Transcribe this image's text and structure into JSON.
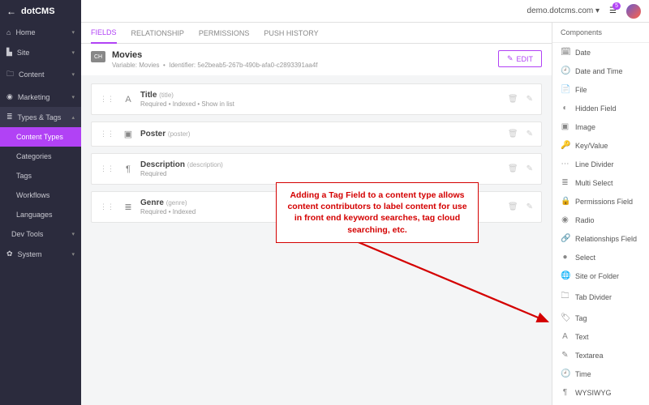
{
  "topbar": {
    "domain": "demo.dotcms.com",
    "notification_count": "5"
  },
  "sidebar": {
    "items": [
      {
        "label": "Home",
        "icon": "⌂"
      },
      {
        "label": "Site",
        "icon": "▙"
      },
      {
        "label": "Content",
        "icon": "🗀"
      },
      {
        "label": "Marketing",
        "icon": "◉"
      },
      {
        "label": "Types & Tags",
        "icon": "≣",
        "open": true,
        "children": [
          {
            "label": "Content Types",
            "active": true
          },
          {
            "label": "Categories"
          },
          {
            "label": "Tags"
          },
          {
            "label": "Workflows"
          },
          {
            "label": "Languages"
          }
        ]
      },
      {
        "label": "Dev Tools",
        "icon": "</>"
      },
      {
        "label": "System",
        "icon": "✿"
      }
    ]
  },
  "tabs": [
    {
      "label": "FIELDS",
      "active": true
    },
    {
      "label": "RELATIONSHIP"
    },
    {
      "label": "PERMISSIONS"
    },
    {
      "label": "PUSH HISTORY"
    }
  ],
  "content_type": {
    "icon_label": "CH",
    "name": "Movies",
    "variable_label": "Variable: Movies",
    "identifier_label": "Identifier: 5e2beab5-267b-490b-afa0-c2893391aa4f",
    "edit_label": "EDIT"
  },
  "fields": [
    {
      "icon": "A",
      "name": "Title",
      "var": "(title)",
      "attrs": "Required  •  Indexed  •  Show in list"
    },
    {
      "icon": "▣",
      "name": "Poster",
      "var": "(poster)",
      "attrs": ""
    },
    {
      "icon": "¶",
      "name": "Description",
      "var": "(description)",
      "attrs": "Required"
    },
    {
      "icon": "≣",
      "name": "Genre",
      "var": "(genre)",
      "attrs": "Required  •  Indexed"
    }
  ],
  "components": {
    "header": "Components",
    "items": [
      {
        "icon": "🗓",
        "label": "Date"
      },
      {
        "icon": "🕘",
        "label": "Date and Time"
      },
      {
        "icon": "📄",
        "label": "File"
      },
      {
        "icon": "◐",
        "label": "Hidden Field"
      },
      {
        "icon": "▣",
        "label": "Image"
      },
      {
        "icon": "🔑",
        "label": "Key/Value"
      },
      {
        "icon": "⋯",
        "label": "Line Divider"
      },
      {
        "icon": "≣",
        "label": "Multi Select"
      },
      {
        "icon": "🔒",
        "label": "Permissions Field"
      },
      {
        "icon": "◉",
        "label": "Radio"
      },
      {
        "icon": "🔗",
        "label": "Relationships Field"
      },
      {
        "icon": "●",
        "label": "Select"
      },
      {
        "icon": "🌐",
        "label": "Site or Folder"
      },
      {
        "icon": "🗀",
        "label": "Tab Divider"
      },
      {
        "icon": "🏷",
        "label": "Tag"
      },
      {
        "icon": "A",
        "label": "Text"
      },
      {
        "icon": "✎",
        "label": "Textarea"
      },
      {
        "icon": "🕘",
        "label": "Time"
      },
      {
        "icon": "¶",
        "label": "WYSIWYG"
      }
    ]
  },
  "callout": {
    "text": "Adding a Tag Field to a content type allows content contributors to label content for use in front end keyword searches, tag cloud  searching, etc."
  }
}
